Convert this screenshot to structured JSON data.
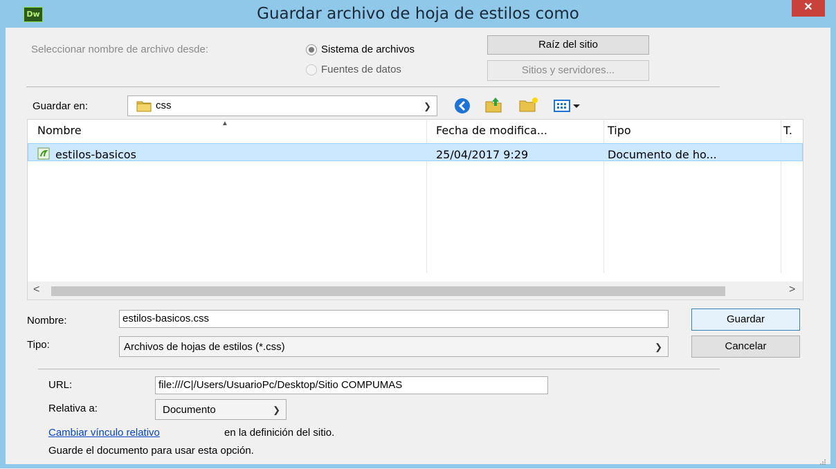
{
  "window": {
    "title": "Guardar archivo de hoja de estilos como",
    "app_icon_label": "Dw",
    "close_label": "✕"
  },
  "source": {
    "label": "Seleccionar nombre de archivo desde:",
    "option_filesystem": "Sistema de archivos",
    "option_datasources": "Fuentes de datos",
    "selected": "Sistema de archivos",
    "site_root_button": "Raíz del sitio",
    "sites_servers_button": "Sitios y servidores..."
  },
  "location": {
    "label": "Guardar en:",
    "folder": "css"
  },
  "toolbar": {
    "icons": [
      "back-icon",
      "up-folder-icon",
      "new-folder-icon",
      "view-menu-icon"
    ]
  },
  "file_list": {
    "columns": [
      "Nombre",
      "Fecha de modifica...",
      "Tipo",
      "T."
    ],
    "rows": [
      {
        "name": "estilos-basicos",
        "date": "25/04/2017 9:29",
        "type": "Documento de ho..."
      }
    ]
  },
  "filename": {
    "label": "Nombre:",
    "value": "estilos-basicos.css"
  },
  "filetype": {
    "label": "Tipo:",
    "value": "Archivos de hojas de estilos (*.css)"
  },
  "buttons": {
    "save": "Guardar",
    "cancel": "Cancelar"
  },
  "url": {
    "label": "URL:",
    "value": "file:///C|/Users/UsuarioPc/Desktop/Sitio COMPUMAS"
  },
  "relative": {
    "label": "Relativa a:",
    "value": "Documento"
  },
  "footer": {
    "link": "Cambiar vínculo relativo",
    "link_suffix": "en la definición del sitio.",
    "note": "Guarde el documento para usar esta opción."
  },
  "colors": {
    "titlebar": "#8fc8e8",
    "selection": "#cce8ff",
    "link": "#0645c9",
    "close": "#c8413a"
  }
}
